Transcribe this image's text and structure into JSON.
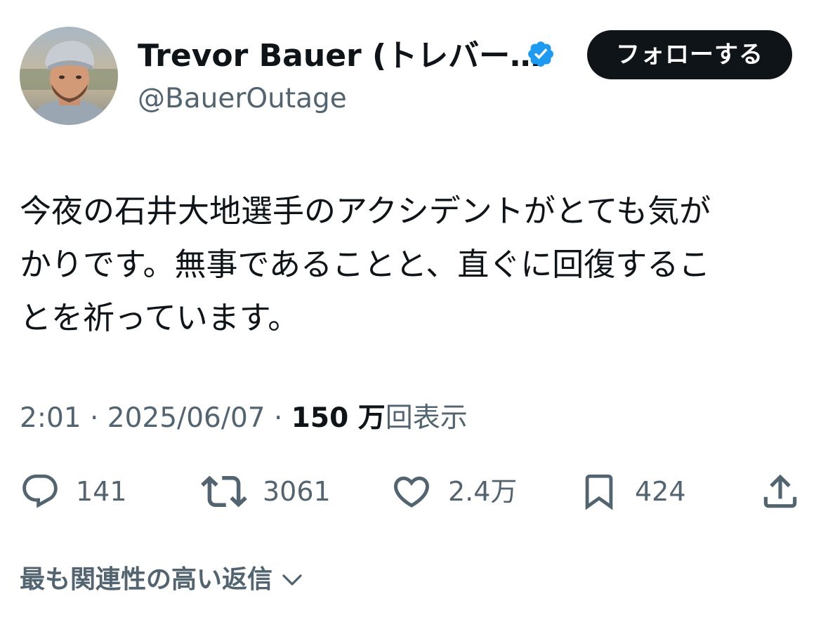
{
  "author": {
    "display_name": "Trevor Bauer (トレバー…",
    "handle": "@BauerOutage",
    "verified": true
  },
  "follow_button": {
    "label": "フォローする"
  },
  "tweet": {
    "text_lines": [
      "今夜の石井大地選手のアクシデントがとても気が",
      "かりです。無事であることと、直ぐに回復するこ",
      "とを祈っています。"
    ],
    "time": "2:01",
    "separator": " · ",
    "date": "2025/06/07",
    "views_count": "150 万",
    "views_label": "回表示"
  },
  "actions": {
    "reply_count": "141",
    "retweet_count": "3061",
    "like_count": "2.4万",
    "bookmark_count": "424"
  },
  "replies": {
    "sort_label": "最も関連性の高い返信"
  },
  "colors": {
    "text_primary": "#0f1419",
    "text_secondary": "#536471",
    "verified_blue": "#1d9bf0",
    "button_bg": "#0f1419"
  },
  "icons": [
    "avatar-photo",
    "verified-badge-icon",
    "reply-icon",
    "retweet-icon",
    "like-icon",
    "bookmark-icon",
    "share-icon",
    "chevron-down-icon"
  ]
}
